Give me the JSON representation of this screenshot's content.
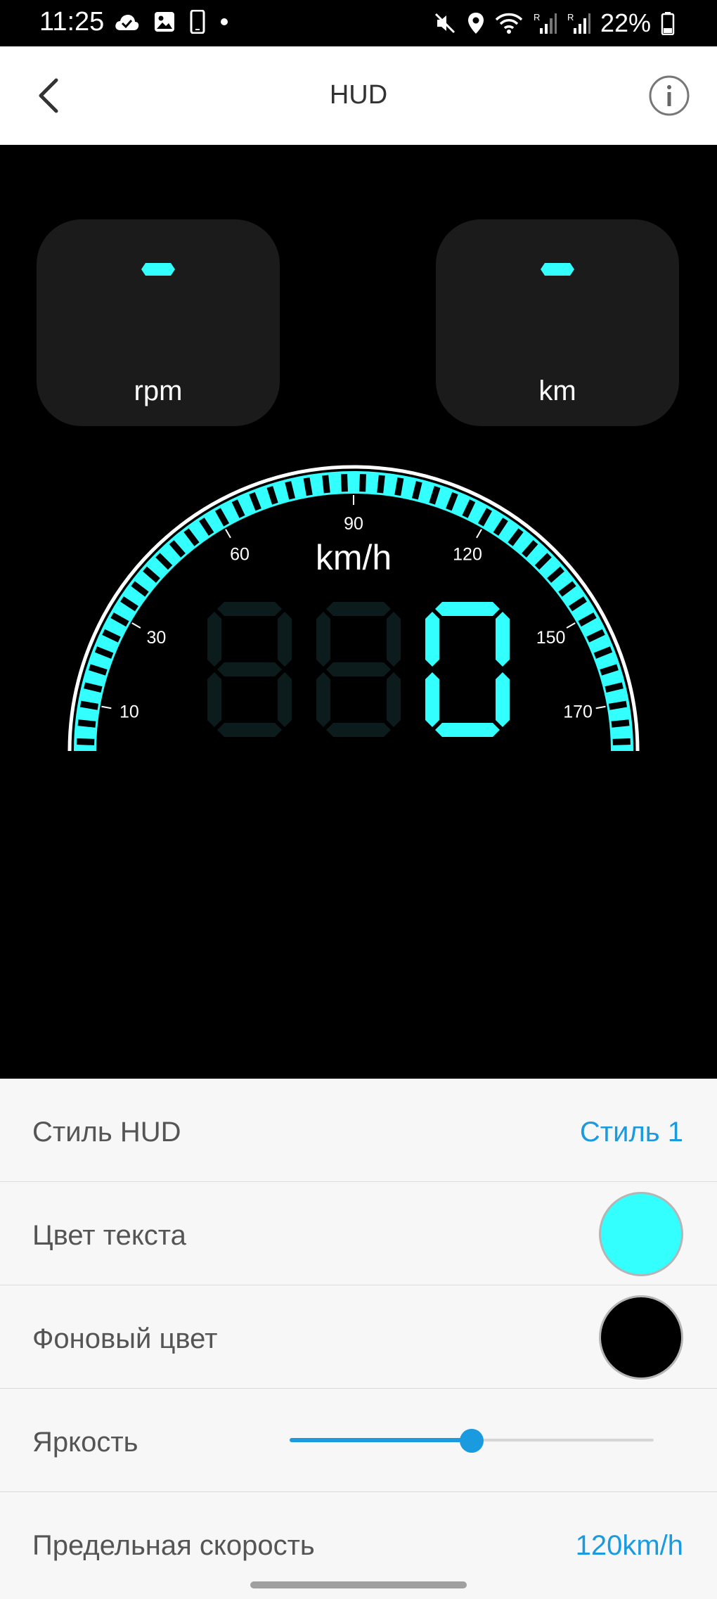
{
  "status_bar": {
    "time": "11:25",
    "battery": "22%"
  },
  "app_bar": {
    "title": "HUD",
    "back_icon": "chevron-left-icon",
    "info_icon": "info-icon"
  },
  "hud": {
    "rpm_tile": {
      "value": "-",
      "label": "rpm"
    },
    "distance_tile": {
      "value": "-",
      "label": "km"
    },
    "gauge": {
      "unit": "km/h",
      "tick_labels": [
        "10",
        "30",
        "60",
        "90",
        "120",
        "150",
        "170"
      ],
      "speed_digits": [
        "0",
        "0",
        "0"
      ],
      "active_digit_count": 1
    },
    "colors": {
      "accent": "#33ffff",
      "background": "#000000",
      "dim_digit": "#0c1c1c"
    }
  },
  "settings": {
    "hud_style": {
      "label": "Стиль HUD",
      "value": "Стиль 1"
    },
    "text_color": {
      "label": "Цвет текста",
      "color": "#33ffff"
    },
    "background_color": {
      "label": "Фоновый цвет",
      "color": "#000000"
    },
    "brightness": {
      "label": "Яркость",
      "level": 0.5
    },
    "speed_limit": {
      "label": "Предельная скорость",
      "value": "120km/h"
    }
  }
}
